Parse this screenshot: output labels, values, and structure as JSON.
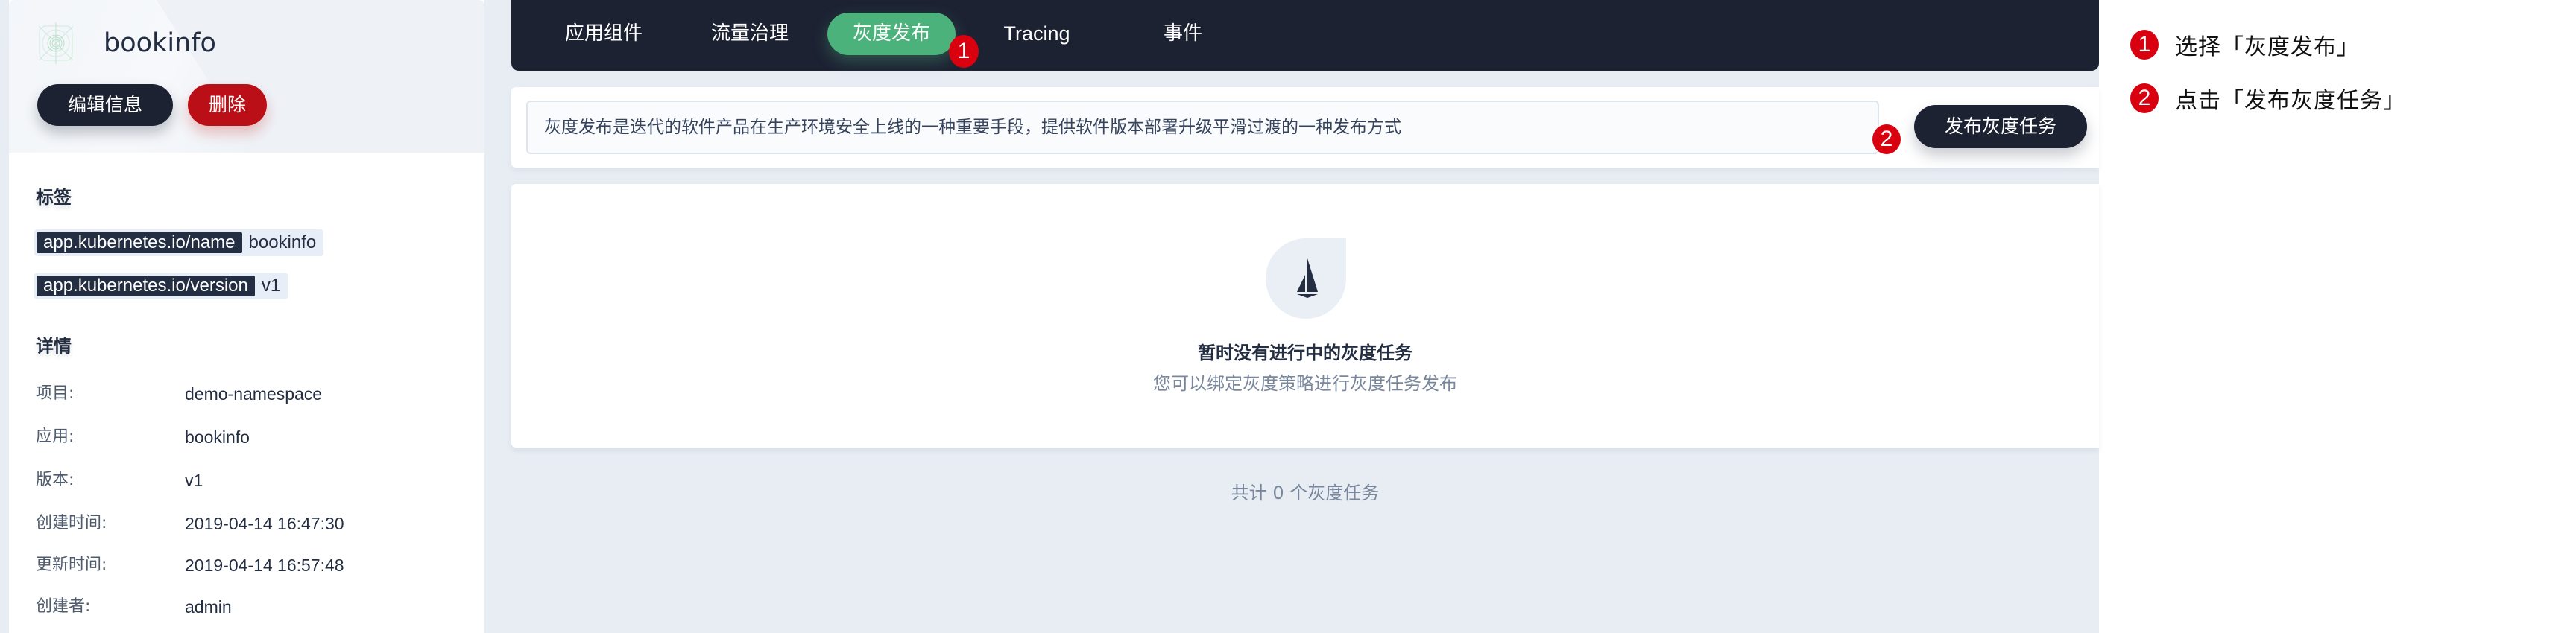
{
  "app": {
    "name": "bookinfo",
    "edit_label": "编辑信息",
    "delete_label": "删除"
  },
  "labels": {
    "title": "标签",
    "items": [
      {
        "key": "app.kubernetes.io/name",
        "value": "bookinfo"
      },
      {
        "key": "app.kubernetes.io/version",
        "value": "v1"
      }
    ]
  },
  "details": {
    "title": "详情",
    "rows": [
      {
        "label": "项目:",
        "value": "demo-namespace"
      },
      {
        "label": "应用:",
        "value": "bookinfo"
      },
      {
        "label": "版本:",
        "value": "v1"
      },
      {
        "label": "创建时间:",
        "value": "2019-04-14 16:47:30"
      },
      {
        "label": "更新时间:",
        "value": "2019-04-14 16:57:48"
      },
      {
        "label": "创建者:",
        "value": "admin"
      }
    ]
  },
  "tabs": [
    {
      "label": "应用组件",
      "active": false
    },
    {
      "label": "流量治理",
      "active": false
    },
    {
      "label": "灰度发布",
      "active": true
    },
    {
      "label": "Tracing",
      "active": false
    },
    {
      "label": "事件",
      "active": false
    }
  ],
  "description": "灰度发布是迭代的软件产品在生产环境安全上线的一种重要手段，提供软件版本部署升级平滑过渡的一种发布方式",
  "publish_button": "发布灰度任务",
  "empty_state": {
    "icon": "istio-sail-icon",
    "title": "暂时没有进行中的灰度任务",
    "subtitle": "您可以绑定灰度策略进行灰度任务发布"
  },
  "total_count_text": "共计 0 个灰度任务",
  "annotations": [
    {
      "num": "1",
      "text": "选择「灰度发布」"
    },
    {
      "num": "2",
      "text": "点击「发布灰度任务」"
    }
  ],
  "colors": {
    "nav_bg": "#1d2233",
    "active_tab": "#4cb27c",
    "danger": "#ba0f17",
    "step_badge": "#d9000f",
    "page_bg": "#e8edf4"
  }
}
